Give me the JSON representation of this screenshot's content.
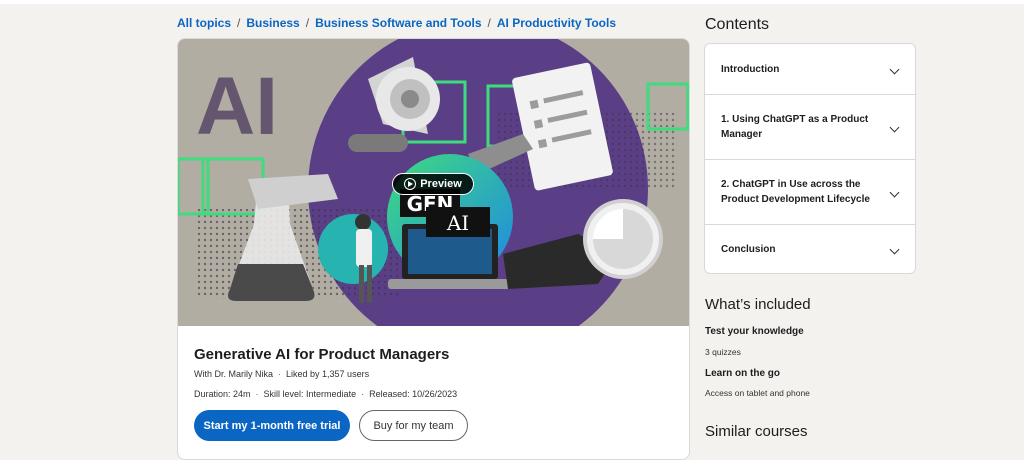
{
  "breadcrumb": {
    "items": [
      "All topics",
      "Business",
      "Business Software and Tools",
      "AI Productivity Tools"
    ],
    "separator": "/"
  },
  "hero": {
    "big_letters": "AI",
    "screen_top": "GEN",
    "screen_bottom": "AI",
    "preview_label": "Preview",
    "colors": {
      "purple": "#5b3f86",
      "green": "#3fdc7e",
      "bg": "#b7b2a8"
    }
  },
  "course": {
    "title": "Generative AI for Product Managers",
    "instructor": "With Dr. Marily Nika",
    "likes": "Liked by 1,357 users",
    "duration": "Duration: 24m",
    "skill": "Skill level: Intermediate",
    "released": "Released: 10/26/2023",
    "primary_cta": "Start my 1-month free trial",
    "secondary_cta": "Buy for my team"
  },
  "contents": {
    "heading": "Contents",
    "items": [
      {
        "label": "Introduction"
      },
      {
        "label": "1. Using ChatGPT as a Product Manager"
      },
      {
        "label": "2. ChatGPT in Use across the Product Development Lifecycle"
      },
      {
        "label": "Conclusion"
      }
    ]
  },
  "included": {
    "heading": "What’s included",
    "items": [
      {
        "title": "Test your knowledge",
        "sub": "3 quizzes"
      },
      {
        "title": "Learn on the go",
        "sub": "Access on tablet and phone"
      }
    ]
  },
  "similar": {
    "heading": "Similar courses"
  },
  "colors": {
    "accent": "#0a66c2",
    "page_bg": "#f3f2ef"
  }
}
